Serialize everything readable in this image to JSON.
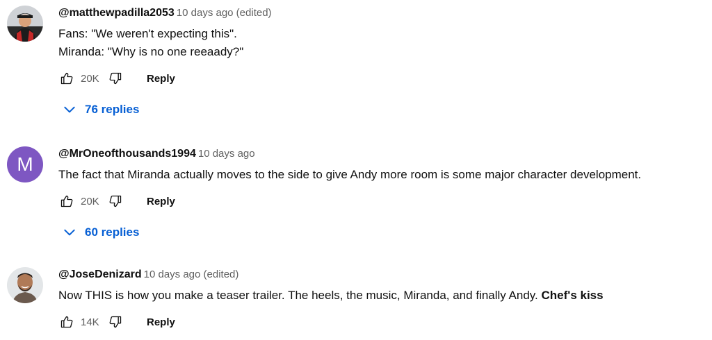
{
  "colors": {
    "link_blue": "#065fd4",
    "meta_gray": "#606060",
    "avatar_purple": "#7e57c2"
  },
  "icons": {
    "like": "thumb-up-outline",
    "dislike": "thumb-down-outline",
    "replies": "chevron-down"
  },
  "comments": [
    {
      "author": "@matthewpadilla2053",
      "meta": "10 days ago (edited)",
      "lines": [
        "Fans: \"We weren't expecting this\".",
        "Miranda: \"Why is no one reeaady?\""
      ],
      "likes": "20K",
      "reply_label": "Reply",
      "replies_label": "76 replies"
    },
    {
      "author": "@MrOneofthousands1994",
      "meta": "10 days ago",
      "avatar_letter": "M",
      "lines": [
        "The fact that Miranda actually moves to the side to give Andy more room is some major character development."
      ],
      "likes": "20K",
      "reply_label": "Reply",
      "replies_label": "60 replies"
    },
    {
      "author": "@JoseDenizard",
      "meta": "10 days ago (edited)",
      "text_plain": "Now THIS is how you make a teaser trailer. The heels, the music, Miranda, and finally Andy. ",
      "text_bold": "Chef's kiss",
      "likes": "14K",
      "reply_label": "Reply"
    }
  ]
}
